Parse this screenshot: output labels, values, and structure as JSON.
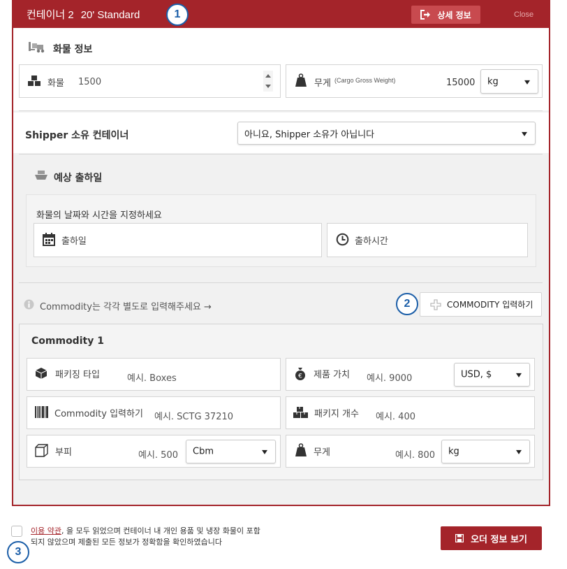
{
  "header": {
    "container_name": "컨테이너 2",
    "container_type": "20' Standard",
    "detail_button": "상세 정보",
    "close_label": "Close"
  },
  "callouts": [
    "1",
    "2",
    "3"
  ],
  "cargo_info": {
    "title": "화물 정보",
    "cargo_label": "화물",
    "cargo_value": "1500",
    "weight_label": "무게",
    "weight_sub": "(Cargo Gross Weight)",
    "weight_value": "15000",
    "weight_unit": "kg"
  },
  "shipper": {
    "label": "Shipper 소유 컨테이너",
    "selected": "아니요, Shipper 소유가 아닙니다"
  },
  "ship_date": {
    "title": "예상 출하일",
    "instruction": "화물의 날짜와 시간을 지정하세요",
    "date_placeholder": "출하일",
    "time_placeholder": "출하시간"
  },
  "commodity_hint": "Commodity는 각각 별도로 입력해주세요 →",
  "commodity_button": "COMMODITY 입력하기",
  "commodity": {
    "title": "Commodity 1",
    "packaging_label": "패키징 타입",
    "packaging_placeholder": "예시. Boxes",
    "value_label": "제품 가치",
    "value_placeholder": "예시. 9000",
    "currency": "USD, $",
    "code_label": "Commodity 입력하기",
    "code_placeholder": "예시. SCTG 37210",
    "package_count_label": "패키지 개수",
    "package_count_placeholder": "예시. 400",
    "volume_label": "부피",
    "volume_placeholder": "예시. 500",
    "volume_unit": "Cbm",
    "weight_label": "무게",
    "weight_placeholder": "예시. 800",
    "weight_unit": "kg"
  },
  "footer": {
    "terms_link": "이용 약관",
    "terms_text_1": ", 을 모두 읽었으며 컨테이너 내 개인 용품 및 냉장 화물이 포함",
    "terms_text_2": "되지 않았으며 제출된 모든 정보가 정확함을 확인하였습니다",
    "order_button": "오더 정보 보기"
  },
  "colors": {
    "brand": "#a4242a",
    "callout": "#1b5ea8"
  }
}
